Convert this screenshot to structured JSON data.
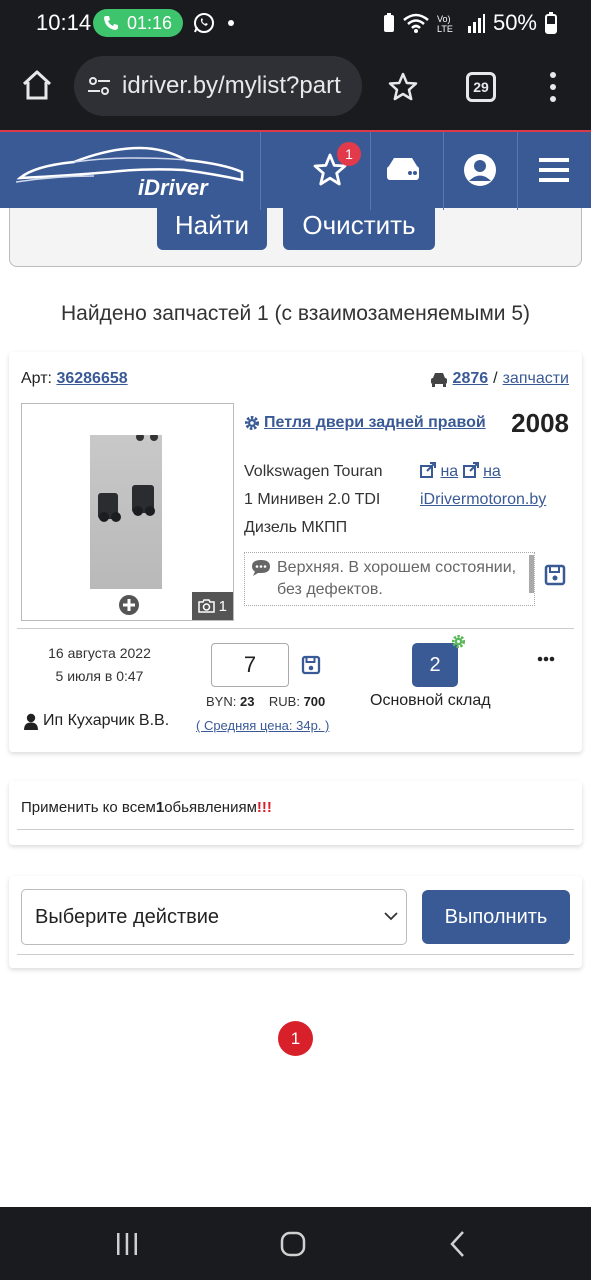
{
  "status_bar": {
    "time": "10:14",
    "call_timer": "01:16",
    "battery": "50%"
  },
  "browser": {
    "url": "idriver.by/mylist?part",
    "tab_count": "29"
  },
  "header": {
    "logo_text": "iDriver",
    "favorites_count": "1"
  },
  "search": {
    "find_label": "Найти",
    "clear_label": "Очистить"
  },
  "results": {
    "found_text": "Найдено запчастей 1 (с взаимозаменяемыми 5)"
  },
  "part": {
    "art_label": "Арт:",
    "art_number": "36286658",
    "car_id": "2876",
    "separator": "/",
    "parts_link": "запчасти",
    "photo_count": "1",
    "title": "Петля двери задней правой",
    "year": "2008",
    "car_model": "Volkswagen Touran",
    "car_body": "1 Минивен 2.0 TDI",
    "car_engine": "Дизель МКПП",
    "ext_link_1": "на",
    "ext_link_2": "на",
    "store_link": "iDrivermotoron.by",
    "comment": "Верхняя. В хорошем состоянии, без дефектов.",
    "date_added": "16 августа 2022",
    "date_updated": "5 июля в 0:47",
    "seller": "Ип Кухарчик В.В.",
    "quantity": "7",
    "byn_label": "BYN:",
    "byn_value": "23",
    "rub_label": "RUB:",
    "rub_value": "700",
    "avg_price": "( Средняя цена: 34р. )",
    "stock_number": "2",
    "stock_name": "Основной склад"
  },
  "apply": {
    "text_before": "Применить ко всем",
    "count": "1",
    "text_after": "обьявлениям",
    "exclaim": "!!!"
  },
  "action": {
    "select_value": "Выберите действие",
    "execute_label": "Выполнить"
  },
  "pagination": {
    "current_page": "1"
  },
  "colors": {
    "brand_blue": "#3a5a96",
    "accent_red": "#d8202a",
    "call_green": "#3ec46d"
  }
}
